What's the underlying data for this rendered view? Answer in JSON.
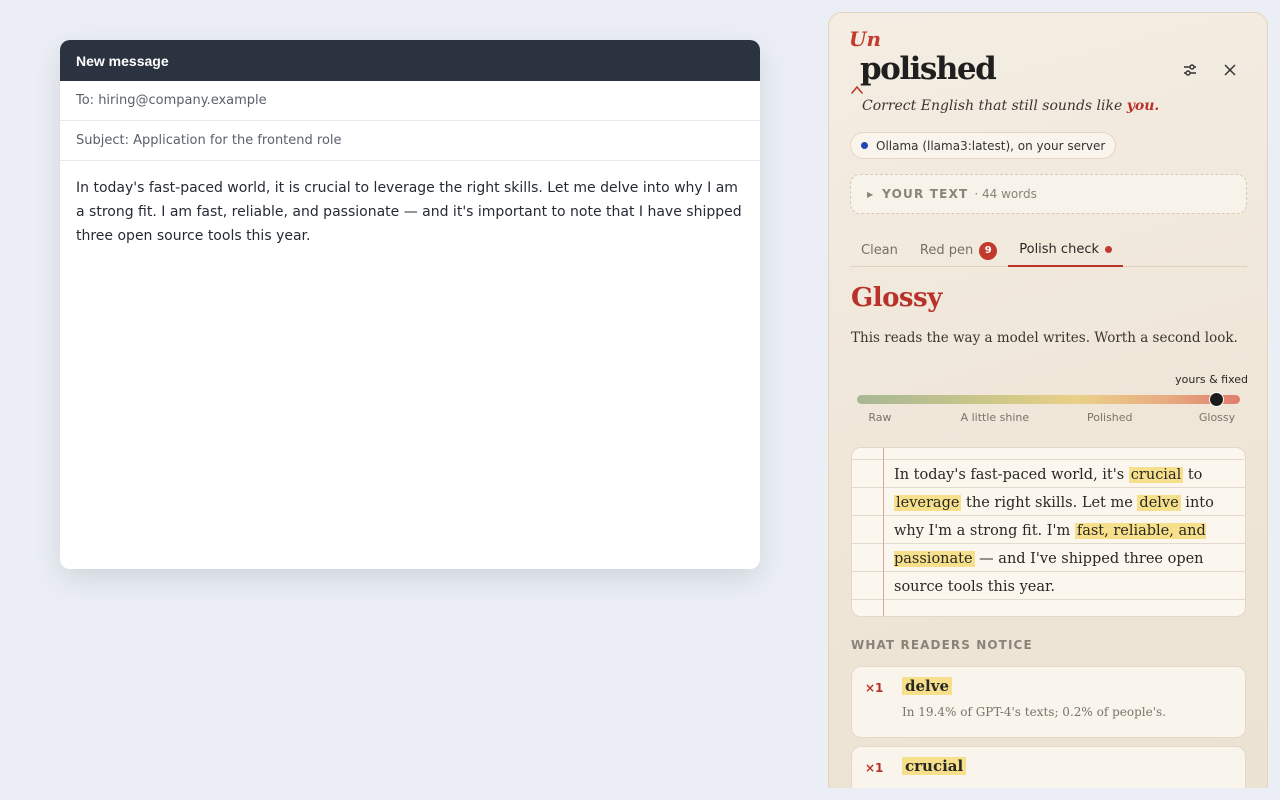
{
  "compose": {
    "header_title": "New message",
    "to_field": "To: hiring@company.example",
    "subject_field": "Subject: Application for the frontend role",
    "body": "In today's fast-paced world, it is crucial to leverage the right skills. Let me delve into why I am a strong fit. I am fast, reliable, and passionate — and it's important to note that I have shipped three open source tools this year."
  },
  "panel": {
    "logo_prefix": "Un",
    "logo_word": "polished",
    "tagline_text": "Correct English that still sounds like ",
    "tagline_accent": "you.",
    "model_status": "Ollama (llama3:latest), on your server",
    "model_status_color": "#2446b4",
    "your_text_label": "YOUR TEXT",
    "your_text_count": "· 44 words",
    "tabs": {
      "clean": "Clean",
      "red_pen": "Red pen",
      "red_pen_badge": "9",
      "polish_check": "Polish check"
    },
    "verdict": {
      "title": "Glossy",
      "description": "This reads the way a model writes. Worth a second look."
    },
    "meter": {
      "marker_label": "yours & fixed",
      "labels": [
        "Raw",
        "A little shine",
        "Polished",
        "Glossy"
      ],
      "level": 0.94
    },
    "rewrite": {
      "segments": [
        {
          "text": "In today's fast-paced world, it's ",
          "hl": false
        },
        {
          "text": "crucial",
          "hl": true
        },
        {
          "text": " to ",
          "hl": false
        },
        {
          "text": "leverage",
          "hl": true
        },
        {
          "text": " the right skills. Let me ",
          "hl": false
        },
        {
          "text": "delve",
          "hl": true
        },
        {
          "text": " into why I'm a strong fit. I'm ",
          "hl": false
        },
        {
          "text": "fast, reliable, and passionate",
          "hl": true
        },
        {
          "text": " — and I've shipped three open source tools this year.",
          "hl": false
        }
      ]
    },
    "notice_title": "WHAT READERS NOTICE",
    "notices": [
      {
        "count": "×1",
        "word": "delve",
        "description": "In 19.4% of GPT-4's texts; 0.2% of people's."
      },
      {
        "count": "×1",
        "word": "crucial",
        "description": ""
      }
    ],
    "accent_color": "#b8322a",
    "highlight_color": "#f6e08c"
  }
}
